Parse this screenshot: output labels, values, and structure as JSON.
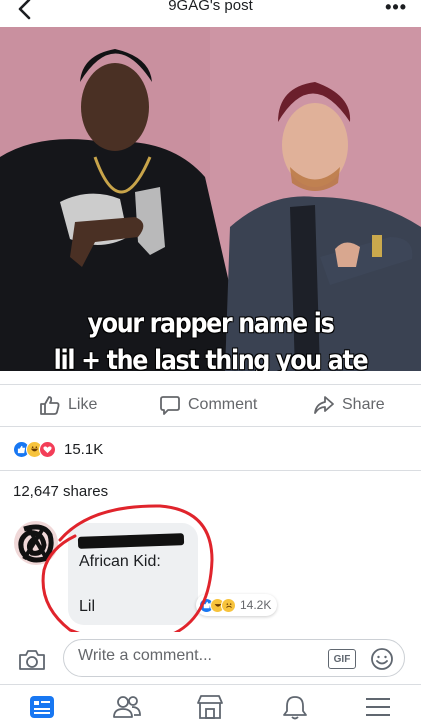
{
  "header": {
    "title": "9GAG's post",
    "back_icon": "chevron-left-icon",
    "more_label": "•••"
  },
  "meme": {
    "caption_line1": "your rapper name is",
    "caption_line2": "lil + the last thing you ate"
  },
  "actions": {
    "like_label": "Like",
    "comment_label": "Comment",
    "share_label": "Share"
  },
  "reactions": {
    "icons": [
      "like-icon",
      "haha-icon",
      "love-icon"
    ],
    "count": "15.1K"
  },
  "shares": {
    "label": "12,647 shares"
  },
  "comment": {
    "text_line1": "African Kid:",
    "text_line2": "Lil",
    "reactions": [
      "like-icon",
      "haha-icon",
      "sad-icon"
    ],
    "reaction_count": "14.2K"
  },
  "write_comment": {
    "placeholder": "Write a comment...",
    "gif_label": "GIF"
  },
  "bottom_nav": {
    "items": [
      "news-feed-icon",
      "friends-icon",
      "marketplace-icon",
      "notifications-icon",
      "menu-icon"
    ]
  },
  "colors": {
    "accent": "#1877f2",
    "text_secondary": "#65676b",
    "annotation_red": "#e0242c"
  }
}
